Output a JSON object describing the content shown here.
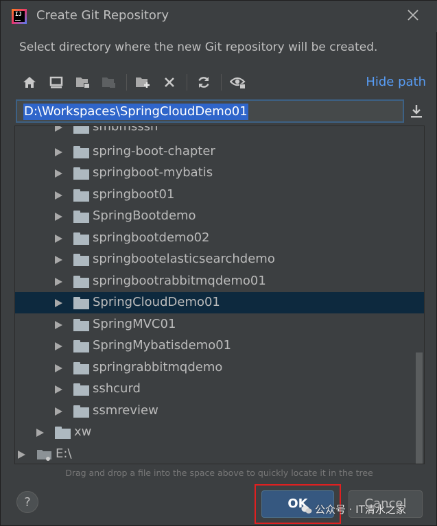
{
  "window": {
    "title": "Create Git Repository",
    "app_icon": "intellij-idea-icon",
    "app_icon_text": "IJ",
    "close_icon": "close-icon"
  },
  "description": "Select directory where the new Git repository will be created.",
  "toolbar": {
    "buttons": [
      {
        "name": "home-icon"
      },
      {
        "name": "desktop-icon"
      },
      {
        "name": "project-folder-icon"
      },
      {
        "name": "module-folder-icon",
        "disabled": true
      },
      {
        "name": "new-folder-icon"
      },
      {
        "name": "delete-icon"
      },
      {
        "name": "refresh-icon"
      },
      {
        "name": "show-hidden-icon"
      }
    ],
    "hide_path_label": "Hide path"
  },
  "path_field": {
    "value": "D:\\Workspaces\\SpringCloudDemo01",
    "selected": true
  },
  "tree": {
    "items": [
      {
        "label": "smbmsssh",
        "partial": true
      },
      {
        "label": "spring-boot-chapter"
      },
      {
        "label": "springboot-mybatis"
      },
      {
        "label": "springboot01"
      },
      {
        "label": "SpringBootdemo"
      },
      {
        "label": "springbootdemo02"
      },
      {
        "label": "springbootelasticsearchdemo"
      },
      {
        "label": "springbootrabbitmqdemo01"
      },
      {
        "label": "SpringCloudDemo01",
        "selected": true
      },
      {
        "label": "SpringMVC01"
      },
      {
        "label": "SpringMybatisdemo01"
      },
      {
        "label": "springrabbitmqdemo"
      },
      {
        "label": "sshcurd"
      },
      {
        "label": "ssmreview"
      },
      {
        "label": "xw"
      },
      {
        "label": "E:\\"
      }
    ]
  },
  "hint": "Drag and drop a file into the space above to quickly locate it in the tree",
  "buttons": {
    "help_label": "?",
    "ok_label": "OK",
    "cancel_label": "Cancel"
  },
  "colors": {
    "background": "#3c3f41",
    "accent": "#589df6",
    "selection": "#0d293e",
    "ok_button": "#365880",
    "highlight_box": "#e02020"
  },
  "watermark": "公众号 · IT清水之家"
}
